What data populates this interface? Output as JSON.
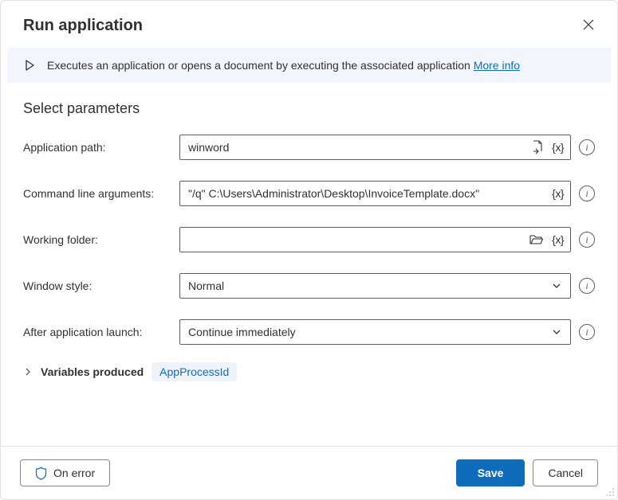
{
  "header": {
    "title": "Run application"
  },
  "banner": {
    "text": "Executes an application or opens a document by executing the associated application ",
    "link": "More info"
  },
  "section": {
    "title": "Select parameters"
  },
  "fields": {
    "appPath": {
      "label": "Application path:",
      "value": "winword"
    },
    "args": {
      "label": "Command line arguments:",
      "value": "\"/q\" C:\\Users\\Administrator\\Desktop\\InvoiceTemplate.docx\""
    },
    "workingFolder": {
      "label": "Working folder:",
      "value": ""
    },
    "windowStyle": {
      "label": "Window style:",
      "value": "Normal"
    },
    "afterLaunch": {
      "label": "After application launch:",
      "value": "Continue immediately"
    }
  },
  "variables": {
    "label": "Variables produced",
    "items": [
      "AppProcessId"
    ]
  },
  "footer": {
    "onError": "On error",
    "save": "Save",
    "cancel": "Cancel"
  },
  "icons": {
    "varToken": "{x}"
  }
}
